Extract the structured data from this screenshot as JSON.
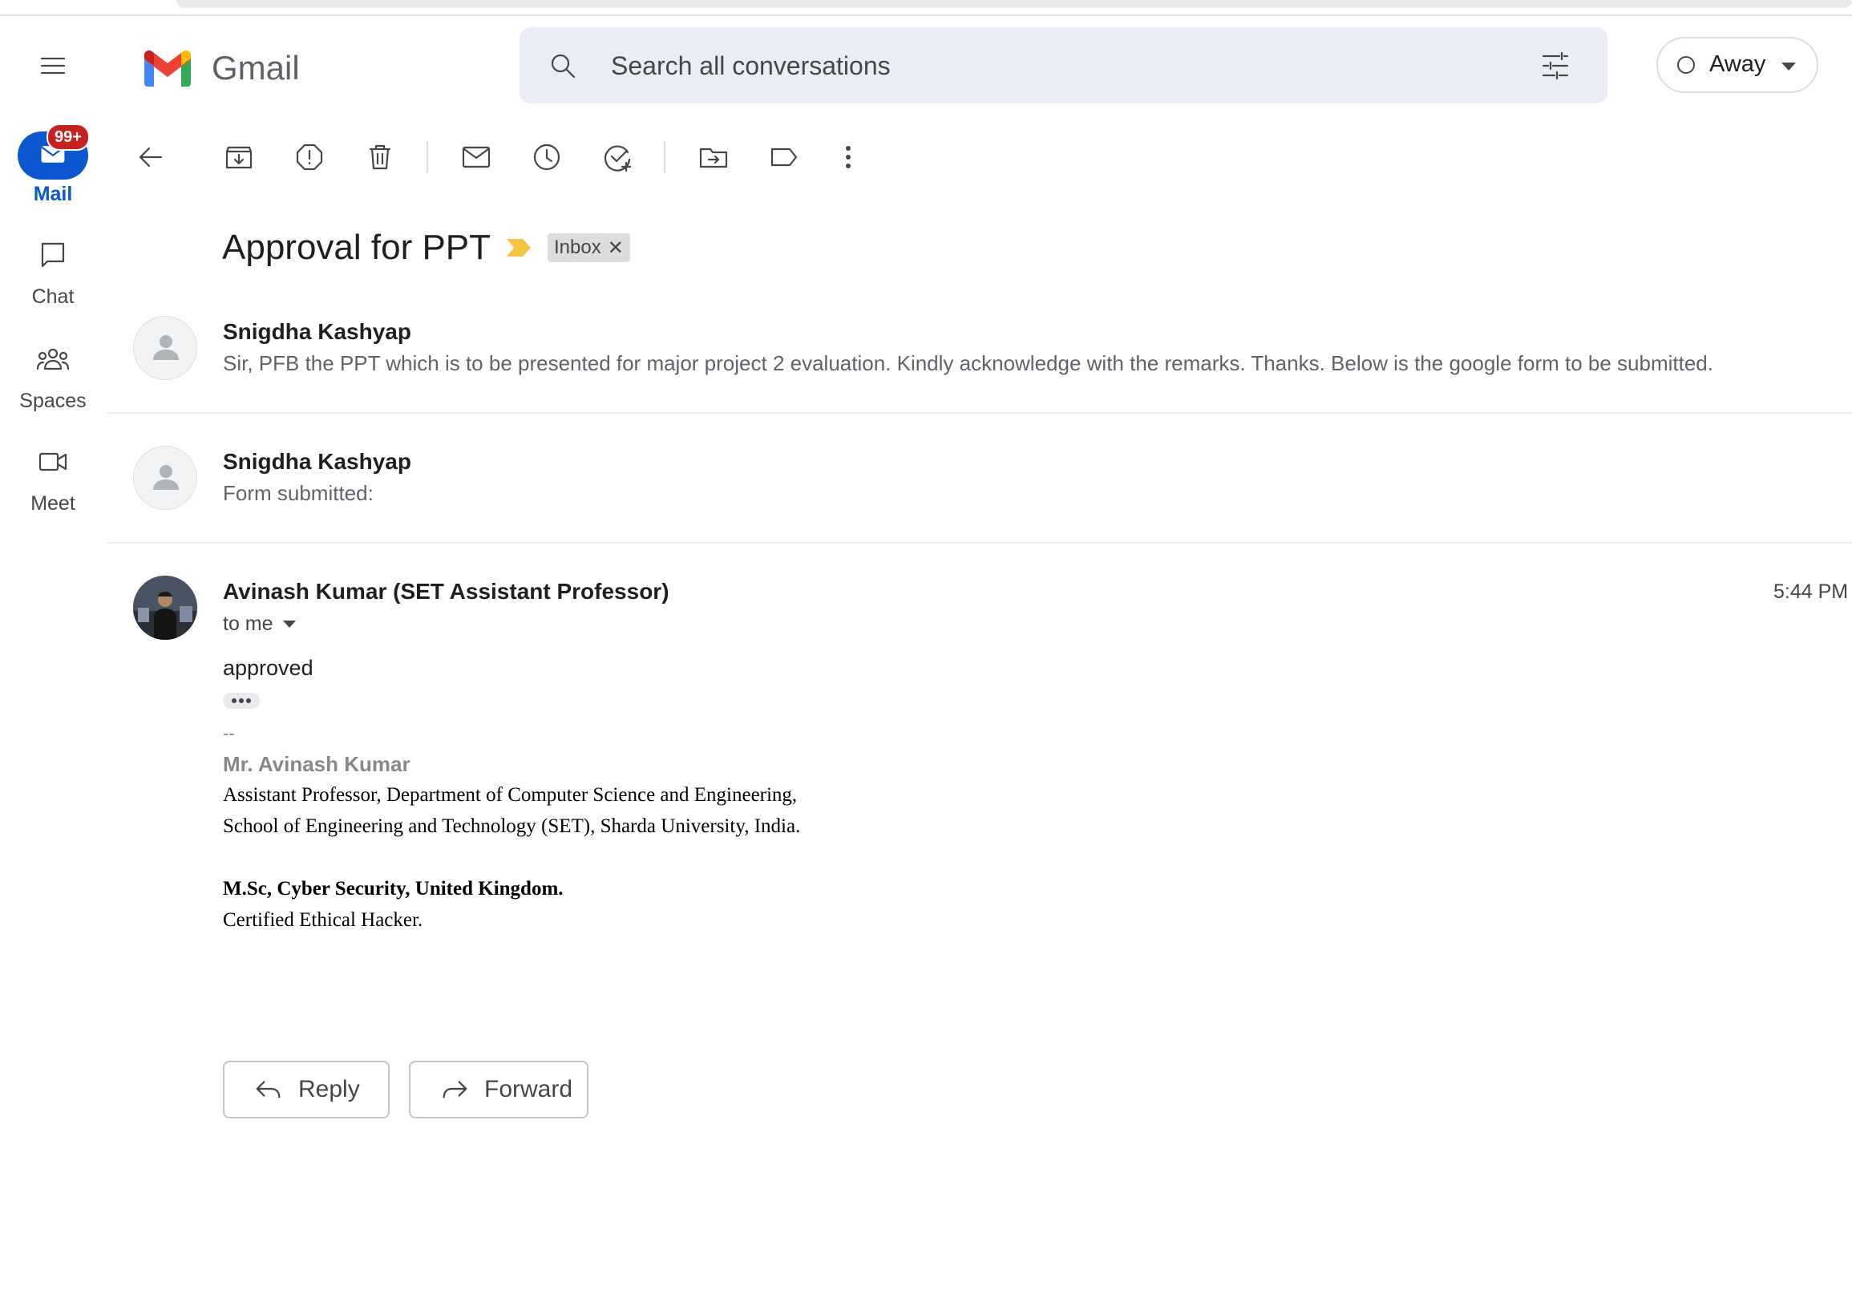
{
  "app": {
    "name": "Gmail",
    "colors": {
      "accent": "#0b57d0",
      "badge": "#c5221f",
      "label_marker": "#f4c542"
    }
  },
  "search": {
    "placeholder": "Search all conversations"
  },
  "status": {
    "label": "Away"
  },
  "nav": {
    "mail": {
      "label": "Mail",
      "badge": "99+"
    },
    "chat": {
      "label": "Chat"
    },
    "spaces": {
      "label": "Spaces"
    },
    "meet": {
      "label": "Meet"
    }
  },
  "toolbar": {
    "icons": [
      "back-arrow-icon",
      "archive-icon",
      "report-spam-icon",
      "delete-icon",
      "mark-unread-icon",
      "snooze-icon",
      "add-task-icon",
      "move-to-icon",
      "label-icon",
      "more-vert-icon"
    ]
  },
  "thread": {
    "subject": "Approval for PPT",
    "label_chip": "Inbox",
    "messages": [
      {
        "sender": "Snigdha Kashyap",
        "snippet": "Sir, PFB the PPT which is to be presented for major project 2 evaluation. Kindly acknowledge with the remarks. Thanks. Below is the google form to be submitted."
      },
      {
        "sender": "Snigdha Kashyap",
        "snippet": "Form submitted:"
      }
    ],
    "open_message": {
      "sender": "Avinash Kumar (SET Assistant Professor)",
      "time": "5:44 PM",
      "recipients": "to me",
      "body": "approved",
      "signature": {
        "separator": "--",
        "name": "Mr. Avinash Kumar",
        "line1": "Assistant Professor, Department of Computer Science and Engineering,",
        "line2": "School of Engineering and Technology (SET), Sharda University, India.",
        "line3": "M.Sc, Cyber Security, United Kingdom.",
        "line4": "Certified Ethical Hacker."
      }
    }
  },
  "actions": {
    "reply": "Reply",
    "forward": "Forward"
  }
}
